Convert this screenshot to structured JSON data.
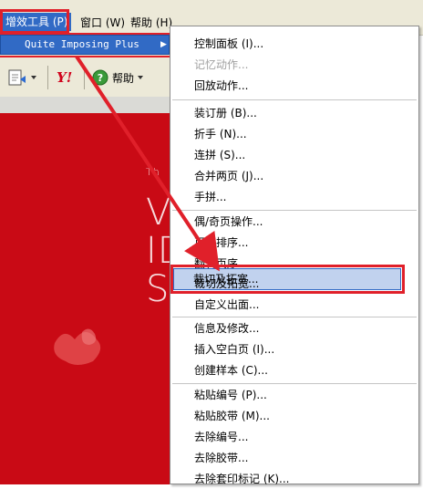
{
  "menubar": {
    "items": [
      {
        "label": "增效工具 (P)"
      },
      {
        "label": "窗口 (W)"
      },
      {
        "label": "帮助 (H)"
      }
    ]
  },
  "submenu": {
    "label": "Quite Imposing Plus",
    "arrow": "▶"
  },
  "toolbar": {
    "help_label": "帮助",
    "yahoo_label": "Y!"
  },
  "background_text": {
    "line1": "Th",
    "line2": "VI",
    "line3": "ID",
    "line4": "SY"
  },
  "dropdown": {
    "items": [
      {
        "label": "控制面板 (I)...",
        "disabled": false
      },
      {
        "label": "记忆动作...",
        "disabled": true
      },
      {
        "label": "回放动作...",
        "disabled": false
      },
      {
        "label": "装订册 (B)...",
        "disabled": false
      },
      {
        "label": "折手 (N)...",
        "disabled": false
      },
      {
        "label": "连拼 (S)...",
        "disabled": false
      },
      {
        "label": "合并两页 (J)...",
        "disabled": false
      },
      {
        "label": "手拼...",
        "disabled": false
      },
      {
        "label": "偶/奇页操作...",
        "disabled": false
      },
      {
        "label": "页面排序...",
        "disabled": false
      },
      {
        "label": "翻转页序...",
        "disabled": false
      },
      {
        "label": "裁切及拓宽...",
        "disabled": false
      },
      {
        "label": "自定义出面...",
        "disabled": false
      },
      {
        "label": "信息及修改...",
        "disabled": false
      },
      {
        "label": "插入空白页 (I)...",
        "disabled": false
      },
      {
        "label": "创建样本 (C)...",
        "disabled": false
      },
      {
        "label": "粘贴编号 (P)...",
        "disabled": false
      },
      {
        "label": "粘贴胶带 (M)...",
        "disabled": false
      },
      {
        "label": "去除编号...",
        "disabled": false
      },
      {
        "label": "去除胶带...",
        "disabled": false
      },
      {
        "label": "去除套印标记 (K)...",
        "disabled": false
      }
    ]
  },
  "colors": {
    "highlight_red": "#e0202a",
    "menu_blue": "#316ac5",
    "background_red": "#c90a15"
  }
}
